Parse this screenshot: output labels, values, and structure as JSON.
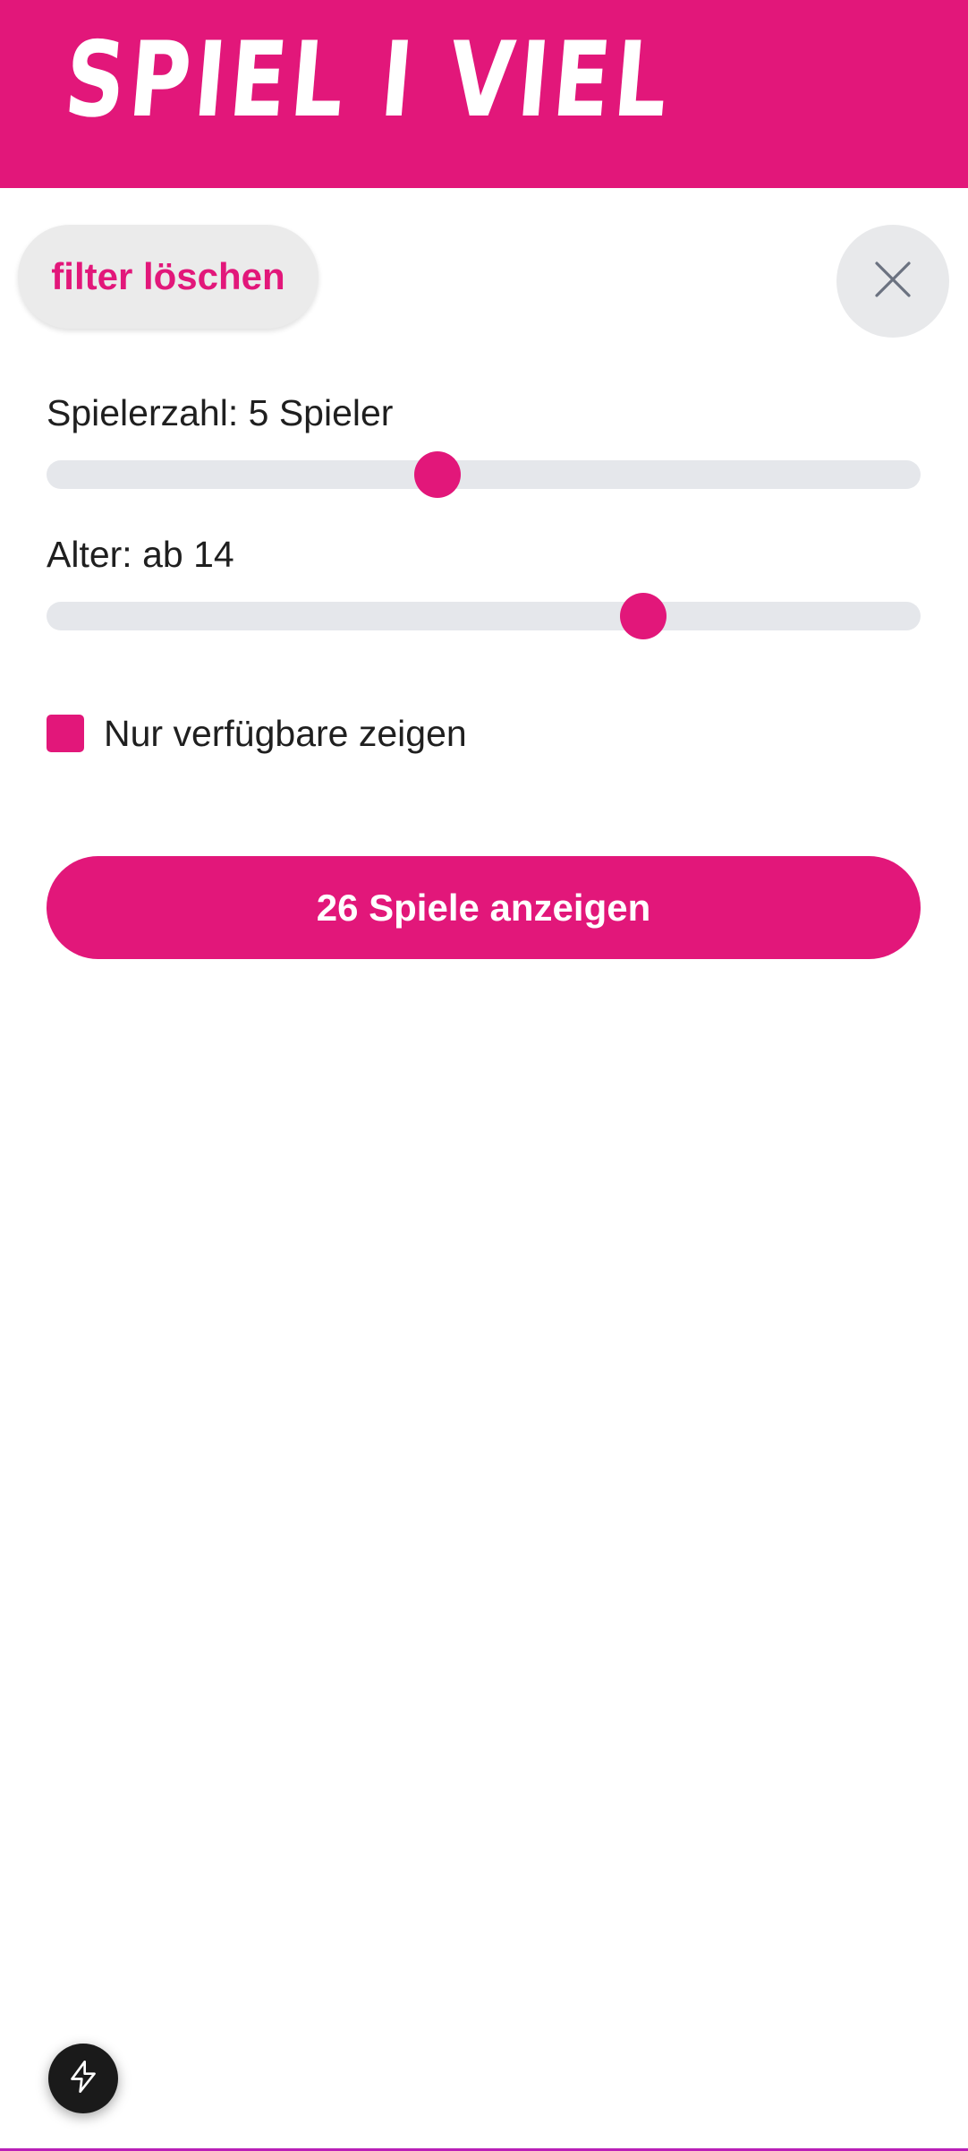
{
  "header": {
    "logo_text": "SPIEL I VIEL",
    "background_color": "#e2177a"
  },
  "filters": {
    "clear_label": "filter löschen",
    "close_icon": "close-icon",
    "players": {
      "label": "Spielerzahl: 5 Spieler",
      "value": 5,
      "position_fraction": 0.447
    },
    "age": {
      "label": "Alter: ab 14",
      "value": 14,
      "position_fraction": 0.683
    },
    "available_only": {
      "label": "Nur verfügbare zeigen",
      "checked": true
    },
    "submit_label": "26 Spiele anzeigen"
  },
  "floating_action": {
    "icon": "lightning-icon"
  },
  "colors": {
    "accent": "#e2177a",
    "track": "#e5e7eb",
    "chip_bg": "#ebebeb",
    "text": "#1f1f1f"
  }
}
